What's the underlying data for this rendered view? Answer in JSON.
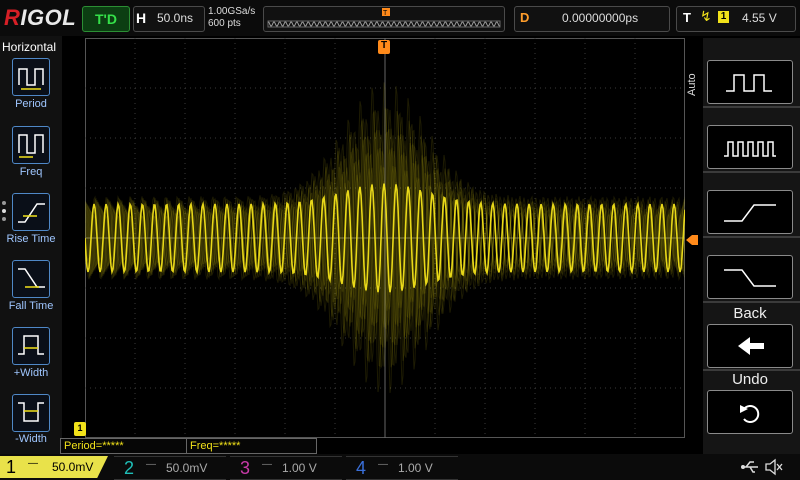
{
  "brand": "RIGOL",
  "top": {
    "run_state": "T'D",
    "h_label": "H",
    "h_value": "50.0ns",
    "sample_rate": "1.00GSa/s",
    "memory_depth": "600 pts",
    "trigger_marker": "T",
    "d_label": "D",
    "delay_value": "0.00000000ps",
    "t_label": "T",
    "trigger_edge": "rising-edge-icon",
    "trigger_source": "1",
    "trigger_level": "4.55 V"
  },
  "left_menu": {
    "title": "Horizontal",
    "items": [
      {
        "label": "Period",
        "icon": "period-icon"
      },
      {
        "label": "Freq",
        "icon": "frequency-icon"
      },
      {
        "label": "Rise Time",
        "icon": "rise-time-icon"
      },
      {
        "label": "Fall Time",
        "icon": "fall-time-icon"
      },
      {
        "label": "+Width",
        "icon": "positive-width-icon"
      },
      {
        "label": "-Width",
        "icon": "negative-width-icon"
      }
    ]
  },
  "screen": {
    "trigger_position_marker": "T",
    "channel1_marker": "1",
    "measurements": [
      "Period=*****",
      "Freq=*****"
    ]
  },
  "right_menu": {
    "mode_label": "Auto",
    "buttons": [
      {
        "icon": "square-wave-slow-icon"
      },
      {
        "icon": "square-wave-fast-icon"
      },
      {
        "icon": "rising-edge-icon"
      },
      {
        "icon": "falling-edge-icon"
      },
      {
        "label": "Back",
        "icon": "back-arrow-icon"
      },
      {
        "label": "Undo",
        "icon": "undo-icon"
      }
    ]
  },
  "channels": [
    {
      "num": "1",
      "coupling": "—",
      "scale": "50.0mV",
      "color": "#f2e21a"
    },
    {
      "num": "2",
      "coupling": "—",
      "scale": "50.0mV",
      "color": "#1fbfb8"
    },
    {
      "num": "3",
      "coupling": "—",
      "scale": "1.00 V",
      "color": "#c83aa8"
    },
    {
      "num": "4",
      "coupling": "—",
      "scale": "1.00 V",
      "color": "#3a6fd8"
    }
  ],
  "colors": {
    "ch1": "#f2e21a",
    "trigger": "#ff8a1a",
    "menu_text": "#9fc6ff",
    "run": "#35e049"
  }
}
